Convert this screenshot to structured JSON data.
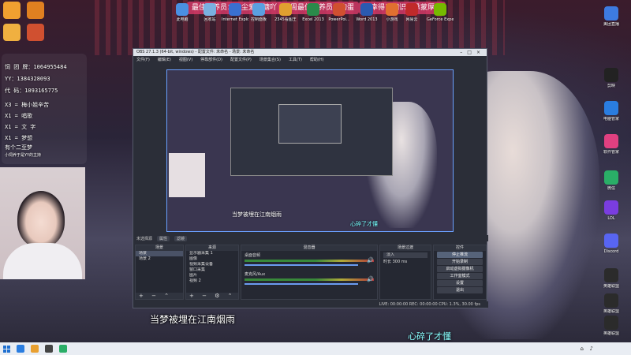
{
  "banners": {
    "banner1": "最佳饲养员：凡尘爱吃糖吖",
    "banner2": "上周最佳饲养员：狗蛋",
    "banner3": "万幸得以相识，承蒙厚爱"
  },
  "desktop_icons_left": [
    {
      "label": "",
      "icon": "game-app-icon",
      "color": "#f0a030"
    },
    {
      "label": "",
      "icon": "game-app-icon",
      "color": "#e08020"
    },
    {
      "label": "",
      "icon": "app-icon",
      "color": "#f0b040"
    },
    {
      "label": "",
      "icon": "app-icon",
      "color": "#d05030"
    }
  ],
  "desktop_icons_top": [
    {
      "label": "此电脑",
      "icon": "computer-icon"
    },
    {
      "label": "回收站",
      "icon": "recycle-bin-icon"
    },
    {
      "label": "Internet Explorer",
      "icon": "ie-icon"
    },
    {
      "label": "控制面板",
      "icon": "control-panel-icon"
    },
    {
      "label": "2345看图王",
      "icon": "image-viewer-icon"
    },
    {
      "label": "Excel 2013",
      "icon": "excel-icon"
    },
    {
      "label": "PowerPoi...",
      "icon": "powerpoint-icon"
    },
    {
      "label": "Word 2013",
      "icon": "word-icon"
    },
    {
      "label": "小游戏",
      "icon": "game-icon"
    },
    {
      "label": "网易云",
      "icon": "music-icon"
    },
    {
      "label": "GeForce Experience",
      "icon": "nvidia-icon"
    }
  ],
  "desktop_icons_right": [
    {
      "label": "美团直播",
      "icon": "meituan-icon",
      "color": "#3d7be0"
    },
    {
      "label": "剪映",
      "icon": "capcut-icon",
      "color": "#222"
    },
    {
      "label": "电脑管家",
      "icon": "shield-icon",
      "color": "#2a7de0"
    },
    {
      "label": "软件管家",
      "icon": "software-manager-icon",
      "color": "#e04080"
    },
    {
      "label": "微信",
      "icon": "wechat-icon",
      "color": "#2aae67"
    },
    {
      "label": "LOL",
      "icon": "lol-icon",
      "color": "#7a3de0"
    },
    {
      "label": "Discord",
      "icon": "discord-icon",
      "color": "#5865f2"
    },
    {
      "label": "英雄联盟",
      "icon": "league-icon",
      "color": "#2b2b2b"
    },
    {
      "label": "英雄联盟",
      "icon": "league-icon",
      "color": "#2b2b2b"
    },
    {
      "label": "英雄联盟",
      "icon": "league-icon",
      "color": "#2b2b2b"
    }
  ],
  "left_panel": {
    "line1": "饲 团 牌：1064955484",
    "line2": "YY：1384328093",
    "line3": "代 码：1093165775",
    "line4": "X3  = 梅小姐辛苦",
    "line5": "X1  = 唱歌",
    "line6": "X1  = 文 字",
    "line7": "X1  = 梦想",
    "line8": "有个二至梦",
    "line9": "小饲养于是YY的主持"
  },
  "obs": {
    "title": "OBS 27.1.3 (64-bit, windows) - 配置文件: 未命名 - 场景: 未命名",
    "menu": [
      "文件(F)",
      "编辑(E)",
      "视图(V)",
      "停靠部件(D)",
      "配置文件(P)",
      "场景集合(S)",
      "工具(T)",
      "帮助(H)"
    ],
    "toolbar": {
      "no_source": "未选择源",
      "props": "属性",
      "filters": "滤镜"
    },
    "scenes": {
      "header": "场景",
      "items": [
        "场景",
        "场景 2"
      ]
    },
    "sources": {
      "header": "来源",
      "items": [
        "显示器采集 1",
        "图像",
        "视频采集设备",
        "窗口采集",
        "图片",
        "视频 2"
      ]
    },
    "mixer": {
      "header": "混音器",
      "tracks": [
        {
          "name": "桌面音频",
          "level": "0.0 dB"
        },
        {
          "name": "麦克风/Aux",
          "level": "0.0 dB"
        }
      ]
    },
    "transitions": {
      "header": "场景过渡",
      "type": "淡入",
      "duration_label": "时长",
      "duration": "300 ms"
    },
    "controls": {
      "header": "控件",
      "buttons": [
        "停止推流",
        "开始录制",
        "启动虚拟摄像机",
        "工作室模式",
        "设置",
        "退出"
      ]
    },
    "status": "LIVE: 00:00:00   REC: 00:00:00   CPU: 1.3%, 30.00 fps"
  },
  "subtitles": {
    "left": "当梦被埋在江南烟雨",
    "right": "心碎了才懂"
  },
  "preview_subtitles": {
    "left": "当梦被埋在江南烟雨",
    "right": "心碎了才懂"
  },
  "colors": {
    "accent": "#6aa0ff",
    "banner": "#e63c6e",
    "obs_bg": "#2b2e38",
    "taskbar": "#e9edf3"
  }
}
